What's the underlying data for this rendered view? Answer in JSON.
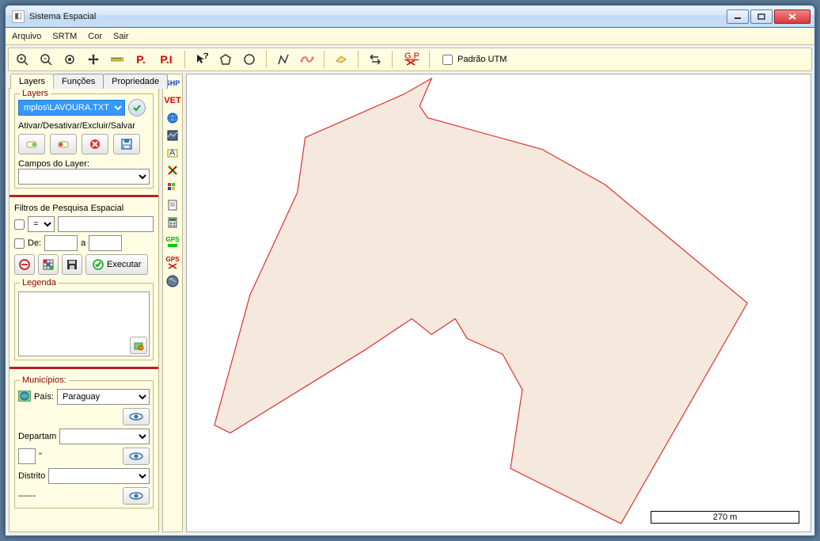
{
  "window": {
    "title": "Sistema Espacial"
  },
  "menu": {
    "arquivo": "Arquivo",
    "srtm": "SRTM",
    "cor": "Cor",
    "sair": "Sair"
  },
  "toolbar": {
    "padrao_utm_label": "Padrão UTM"
  },
  "tabs": {
    "layers": "Layers",
    "funcoes": "Funções",
    "propriedade": "Propriedade"
  },
  "layers_panel": {
    "groupLabel": "Layers",
    "layerSelectValue": "mplos\\LAVOURA.TXT",
    "activeDeactivate": "Ativar/Desativar/Excluir/Salvar",
    "camposLabel": "Campos do Layer:",
    "camposValue": ""
  },
  "filters": {
    "title": "Filtros de Pesquisa Espacial",
    "op": "=",
    "deLabel": "De:",
    "aLabel": "a",
    "executar": "Executar"
  },
  "legend": {
    "title": "Legenda"
  },
  "municipios": {
    "title": "Municípios:",
    "paisLabel": "País:",
    "paisValue": "Paraguay",
    "departLabel": "Departam",
    "departValue": "",
    "quote": "\"",
    "distritoLabel": "Distrito",
    "distritoValue": "",
    "footer": "------"
  },
  "vtoolbar": {
    "shp": "SHP",
    "vet": "VET",
    "gps1": "GPS",
    "gps2": "GPS"
  },
  "scale": {
    "label": "270 m"
  }
}
